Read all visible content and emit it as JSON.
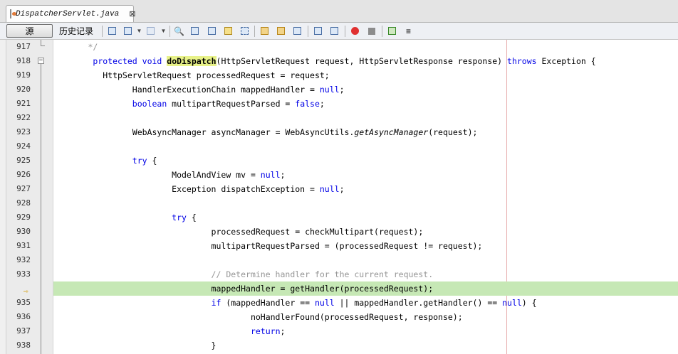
{
  "tab": {
    "filename": "DispatcherServlet.java",
    "close": "⊠"
  },
  "toolbar": {
    "source_label": "源",
    "history_label": "历史记录"
  },
  "gutter": {
    "current_line_marker": "⇨"
  },
  "lines": [
    {
      "num": "917",
      "text": "       */"
    },
    {
      "num": "918",
      "text": ""
    },
    {
      "num": "919",
      "text": "          HttpServletRequest processedRequest = request;"
    },
    {
      "num": "920",
      "text": "          HandlerExecutionChain mappedHandler = null;"
    },
    {
      "num": "921",
      "text": "          boolean multipartRequestParsed = false;"
    },
    {
      "num": "922",
      "text": ""
    },
    {
      "num": "923",
      "text": ""
    },
    {
      "num": "924",
      "text": ""
    },
    {
      "num": "925",
      "text": ""
    },
    {
      "num": "926",
      "text": "                    ModelAndView mv = null;"
    },
    {
      "num": "927",
      "text": "                    Exception dispatchException = null;"
    },
    {
      "num": "928",
      "text": ""
    },
    {
      "num": "929",
      "text": ""
    },
    {
      "num": "930",
      "text": "                              processedRequest = checkMultipart(request);"
    },
    {
      "num": "931",
      "text": "                              multipartRequestParsed = (processedRequest != request);"
    },
    {
      "num": "932",
      "text": ""
    },
    {
      "num": "933",
      "text": "                              // Determine handler for the current request."
    },
    {
      "num": "",
      "text": "                              mappedHandler = getHandler(processedRequest);"
    },
    {
      "num": "935",
      "text": ""
    },
    {
      "num": "936",
      "text": "                                        noHandlerFound(processedRequest, response);"
    },
    {
      "num": "937",
      "text": ""
    },
    {
      "num": "938",
      "text": "                              }"
    }
  ],
  "tokens": {
    "l918_kw1": "protected",
    "l918_kw2": "void",
    "l918_method": "doDispatch",
    "l918_params": "(HttpServletRequest request, HttpServletResponse response) ",
    "l918_throws": "throws",
    "l918_tail": " Exception {",
    "l920_null": "null",
    "l921_kw": "boolean",
    "l921_false": "false",
    "l923_a": "WebAsyncManager asyncManager = WebAsyncUtils.",
    "l923_it": "getAsyncManager",
    "l923_b": "(request);",
    "l925_try": "try",
    "l925_tail": " {",
    "l926_null": "null",
    "l927_null": "null",
    "l929_try": "try",
    "l929_tail": " {",
    "l935_if": "if",
    "l935_a": " (mappedHandler == ",
    "l935_null1": "null",
    "l935_b": " || mappedHandler.getHandler() == ",
    "l935_null2": "null",
    "l935_c": ") {",
    "l937_return": "return",
    "l937_tail": ";"
  }
}
